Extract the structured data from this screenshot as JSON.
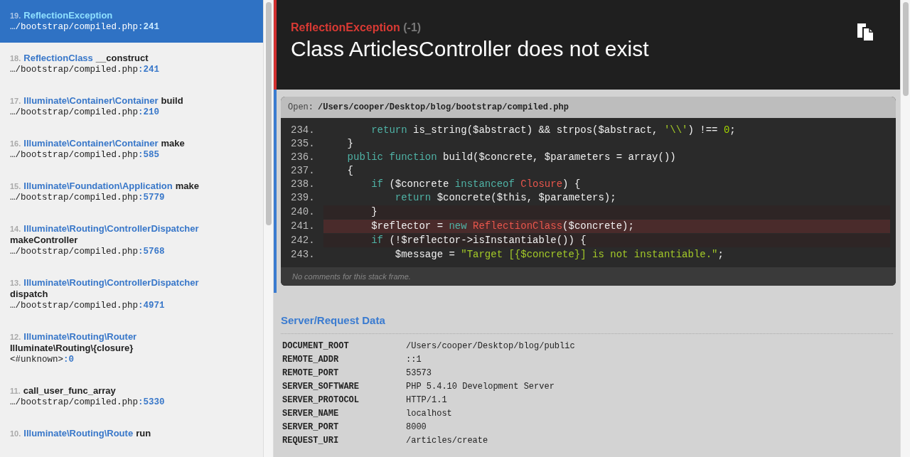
{
  "frames": [
    {
      "number": "19.",
      "class": "ReflectionException",
      "file": "…/bootstrap/compiled.php",
      "line": ":241",
      "selected": true
    },
    {
      "number": "18.",
      "class": "ReflectionClass",
      "method": "__construct",
      "file": "…/bootstrap/compiled.php",
      "line": ":241",
      "selected": false
    },
    {
      "number": "17.",
      "class": "Illuminate\\Container\\Container",
      "method": "build",
      "file": "…/bootstrap/compiled.php",
      "line": ":210",
      "selected": false
    },
    {
      "number": "16.",
      "class": "Illuminate\\Container\\Container",
      "method": "make",
      "file": "…/bootstrap/compiled.php",
      "line": ":585",
      "selected": false
    },
    {
      "number": "15.",
      "class": "Illuminate\\Foundation\\Application",
      "method": "make",
      "file": "…/bootstrap/compiled.php",
      "line": ":5779",
      "selected": false
    },
    {
      "number": "14.",
      "class": "Illuminate\\Routing\\ControllerDispatcher",
      "method": "makeController",
      "file": "…/bootstrap/compiled.php",
      "line": ":5768",
      "selected": false
    },
    {
      "number": "13.",
      "class": "Illuminate\\Routing\\ControllerDispatcher",
      "method": "dispatch",
      "file": "…/bootstrap/compiled.php",
      "line": ":4971",
      "selected": false
    },
    {
      "number": "12.",
      "class": "Illuminate\\Routing\\Router",
      "method": "Illuminate\\Routing\\{closure}",
      "file": "<#unknown>",
      "line": ":0",
      "selected": false
    },
    {
      "number": "11.",
      "method": "call_user_func_array",
      "file": "…/bootstrap/compiled.php",
      "line": ":5330",
      "selected": false
    },
    {
      "number": "10.",
      "class": "Illuminate\\Routing\\Route",
      "method": "run",
      "selected": false
    }
  ],
  "exception": {
    "type": "ReflectionException",
    "code": "(-1)",
    "message": "Class ArticlesController does not exist"
  },
  "code_frame": {
    "open_label": "Open:",
    "path": "/Users/cooper/Desktop/blog/bootstrap/compiled.php",
    "comment": "No comments for this stack frame.",
    "lines": [
      {
        "number": "234.",
        "kind": "normal",
        "tokens": [
          {
            "kind": "keyword",
            "text": "        return"
          },
          {
            "kind": "plain",
            "text": " is_string($abstract) && strpos($abstract, "
          },
          {
            "kind": "string",
            "text": "'\\\\'"
          },
          {
            "kind": "plain",
            "text": ") !== "
          },
          {
            "kind": "number",
            "text": "0"
          },
          {
            "kind": "plain",
            "text": ";"
          }
        ]
      },
      {
        "number": "235.",
        "kind": "normal",
        "tokens": [
          {
            "kind": "plain",
            "text": "    }"
          }
        ]
      },
      {
        "number": "236.",
        "kind": "normal",
        "tokens": [
          {
            "kind": "keyword",
            "text": "    public function"
          },
          {
            "kind": "plain",
            "text": " build($concrete, $parameters = array())"
          }
        ]
      },
      {
        "number": "237.",
        "kind": "normal",
        "tokens": [
          {
            "kind": "plain",
            "text": "    {"
          }
        ]
      },
      {
        "number": "238.",
        "kind": "normal",
        "tokens": [
          {
            "kind": "keyword",
            "text": "        if"
          },
          {
            "kind": "plain",
            "text": " ($concrete "
          },
          {
            "kind": "keyword",
            "text": "instanceof"
          },
          {
            "kind": "class",
            "text": " Closure"
          },
          {
            "kind": "plain",
            "text": ") {"
          }
        ]
      },
      {
        "number": "239.",
        "kind": "normal",
        "tokens": [
          {
            "kind": "keyword",
            "text": "            return"
          },
          {
            "kind": "plain",
            "text": " $concrete($this, $parameters);"
          }
        ]
      },
      {
        "number": "240.",
        "kind": "context",
        "tokens": [
          {
            "kind": "plain",
            "text": "        }"
          }
        ]
      },
      {
        "number": "241.",
        "kind": "error",
        "tokens": [
          {
            "kind": "plain",
            "text": "        $reflector = "
          },
          {
            "kind": "keyword",
            "text": "new"
          },
          {
            "kind": "class",
            "text": " ReflectionClass"
          },
          {
            "kind": "plain",
            "text": "($concrete);"
          }
        ]
      },
      {
        "number": "242.",
        "kind": "context",
        "tokens": [
          {
            "kind": "keyword",
            "text": "        if"
          },
          {
            "kind": "plain",
            "text": " (!$reflector->isInstantiable()) {"
          }
        ]
      },
      {
        "number": "243.",
        "kind": "normal",
        "tokens": [
          {
            "kind": "plain",
            "text": "            $message = "
          },
          {
            "kind": "string",
            "text": "\"Target [{$concrete}] is not instantiable.\""
          },
          {
            "kind": "plain",
            "text": ";"
          }
        ]
      }
    ]
  },
  "server_data": {
    "title": "Server/Request Data",
    "rows": [
      {
        "key": "DOCUMENT_ROOT",
        "value": "/Users/cooper/Desktop/blog/public"
      },
      {
        "key": "REMOTE_ADDR",
        "value": "::1"
      },
      {
        "key": "REMOTE_PORT",
        "value": "53573"
      },
      {
        "key": "SERVER_SOFTWARE",
        "value": "PHP 5.4.10 Development Server"
      },
      {
        "key": "SERVER_PROTOCOL",
        "value": "HTTP/1.1"
      },
      {
        "key": "SERVER_NAME",
        "value": "localhost"
      },
      {
        "key": "SERVER_PORT",
        "value": "8000"
      },
      {
        "key": "REQUEST_URI",
        "value": "/articles/create"
      }
    ]
  }
}
